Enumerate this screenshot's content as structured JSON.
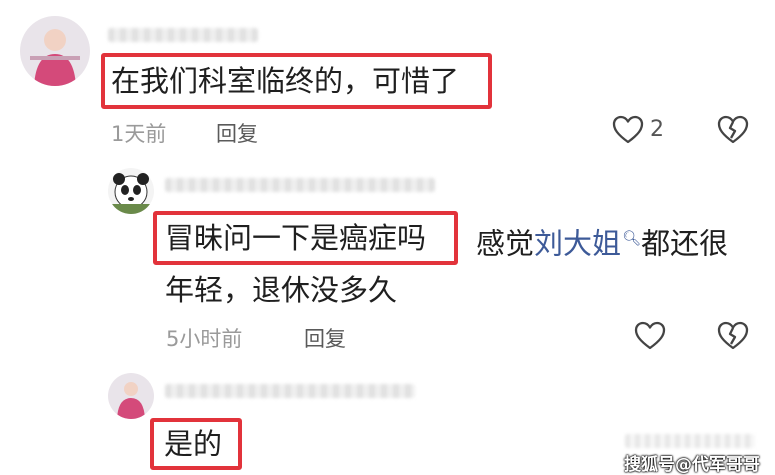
{
  "comments": [
    {
      "text": "在我们科室临终的，可惜了",
      "time": "1天前",
      "reply_label": "回复",
      "like_count": "2"
    },
    {
      "text_highlight": "冒昧问一下是癌症吗",
      "text_rest_before": "感觉",
      "mention": "刘大姐",
      "text_rest_after": "都还很",
      "text_line2": "年轻，退休没多久",
      "time": "5小时前",
      "reply_label": "回复"
    },
    {
      "text": "是的"
    }
  ],
  "watermark": "搜狐号@代军哥哥",
  "colors": {
    "highlight_border": "#e2333b",
    "mention": "#3d5a98"
  }
}
